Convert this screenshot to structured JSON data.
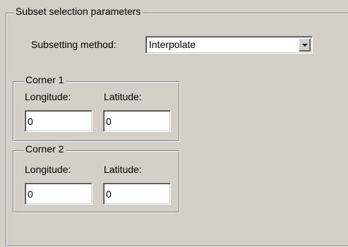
{
  "panel": {
    "title": "Subset selection parameters",
    "method_label": "Subsetting method:",
    "method_value": "Interpolate",
    "corner1": {
      "title": "Corner 1",
      "longitude_label": "Longitude:",
      "latitude_label": "Latitude:",
      "longitude_value": "0",
      "latitude_value": "0"
    },
    "corner2": {
      "title": "Corner 2",
      "longitude_label": "Longitude:",
      "latitude_label": "Latitude:",
      "longitude_value": "0",
      "latitude_value": "0"
    }
  }
}
